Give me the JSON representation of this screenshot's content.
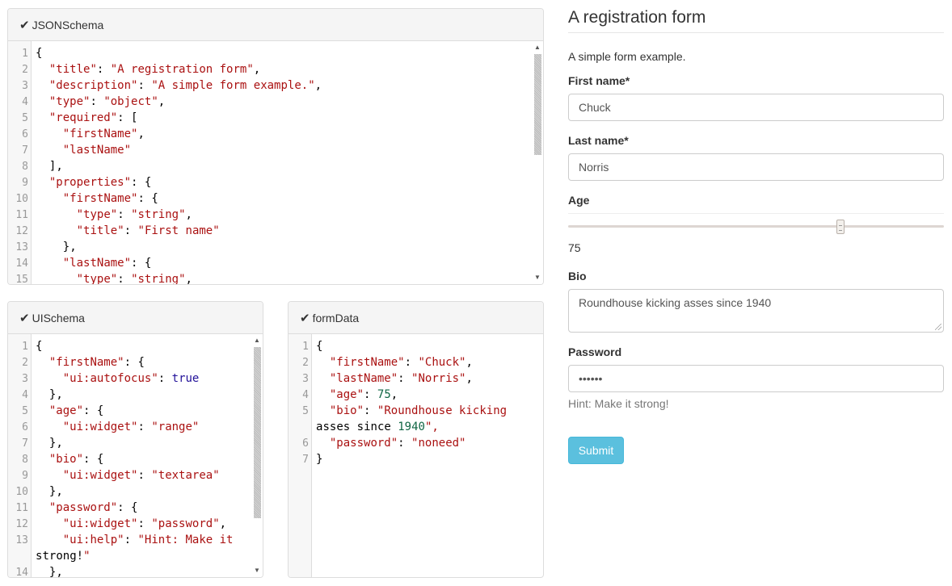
{
  "jsonschema_panel": {
    "title": "JSONSchema",
    "lines": [
      {
        "n": "1",
        "t": "{"
      },
      {
        "n": "2",
        "t": "  \"title\": \"A registration form\","
      },
      {
        "n": "3",
        "t": "  \"description\": \"A simple form example.\","
      },
      {
        "n": "4",
        "t": "  \"type\": \"object\","
      },
      {
        "n": "5",
        "t": "  \"required\": ["
      },
      {
        "n": "6",
        "t": "    \"firstName\","
      },
      {
        "n": "7",
        "t": "    \"lastName\""
      },
      {
        "n": "8",
        "t": "  ],"
      },
      {
        "n": "9",
        "t": "  \"properties\": {"
      },
      {
        "n": "10",
        "t": "    \"firstName\": {"
      },
      {
        "n": "11",
        "t": "      \"type\": \"string\","
      },
      {
        "n": "12",
        "t": "      \"title\": \"First name\""
      },
      {
        "n": "13",
        "t": "    },"
      },
      {
        "n": "14",
        "t": "    \"lastName\": {"
      },
      {
        "n": "15",
        "t": "      \"type\": \"string\","
      }
    ]
  },
  "uischema_panel": {
    "title": "UISchema",
    "lines": [
      {
        "n": "1",
        "t": "{"
      },
      {
        "n": "2",
        "t": "  \"firstName\": {"
      },
      {
        "n": "3",
        "t": "    \"ui:autofocus\": true"
      },
      {
        "n": "4",
        "t": "  },"
      },
      {
        "n": "5",
        "t": "  \"age\": {"
      },
      {
        "n": "6",
        "t": "    \"ui:widget\": \"range\""
      },
      {
        "n": "7",
        "t": "  },"
      },
      {
        "n": "8",
        "t": "  \"bio\": {"
      },
      {
        "n": "9",
        "t": "    \"ui:widget\": \"textarea\""
      },
      {
        "n": "10",
        "t": "  },"
      },
      {
        "n": "11",
        "t": "  \"password\": {"
      },
      {
        "n": "12",
        "t": "    \"ui:widget\": \"password\","
      },
      {
        "n": "13",
        "t": "    \"ui:help\": \"Hint: Make it"
      },
      {
        "n": "",
        "t": "strong!\""
      },
      {
        "n": "14",
        "t": "  },"
      }
    ]
  },
  "formdata_panel": {
    "title": "formData",
    "lines": [
      {
        "n": "1",
        "t": "{"
      },
      {
        "n": "2",
        "t": "  \"firstName\": \"Chuck\","
      },
      {
        "n": "3",
        "t": "  \"lastName\": \"Norris\","
      },
      {
        "n": "4",
        "t": "  \"age\": 75,"
      },
      {
        "n": "5",
        "t": "  \"bio\": \"Roundhouse kicking"
      },
      {
        "n": "",
        "t": "asses since 1940\","
      },
      {
        "n": "6",
        "t": "  \"password\": \"noneed\""
      },
      {
        "n": "7",
        "t": "}"
      }
    ]
  },
  "form": {
    "title": "A registration form",
    "description": "A simple form example.",
    "first_name_label": "First name*",
    "first_name_value": "Chuck",
    "last_name_label": "Last name*",
    "last_name_value": "Norris",
    "age_label": "Age",
    "age_value": "75",
    "age_fraction": 0.73,
    "bio_label": "Bio",
    "bio_value": "Roundhouse kicking asses since 1940",
    "password_label": "Password",
    "password_value": "••••••",
    "password_hint": "Hint: Make it strong!",
    "submit_label": "Submit"
  },
  "icons": {
    "panel_status": "check-icon"
  },
  "colors": {
    "submit": "#5bc0de",
    "string": "#aa1111",
    "number": "#116644",
    "keyword": "#221199"
  }
}
